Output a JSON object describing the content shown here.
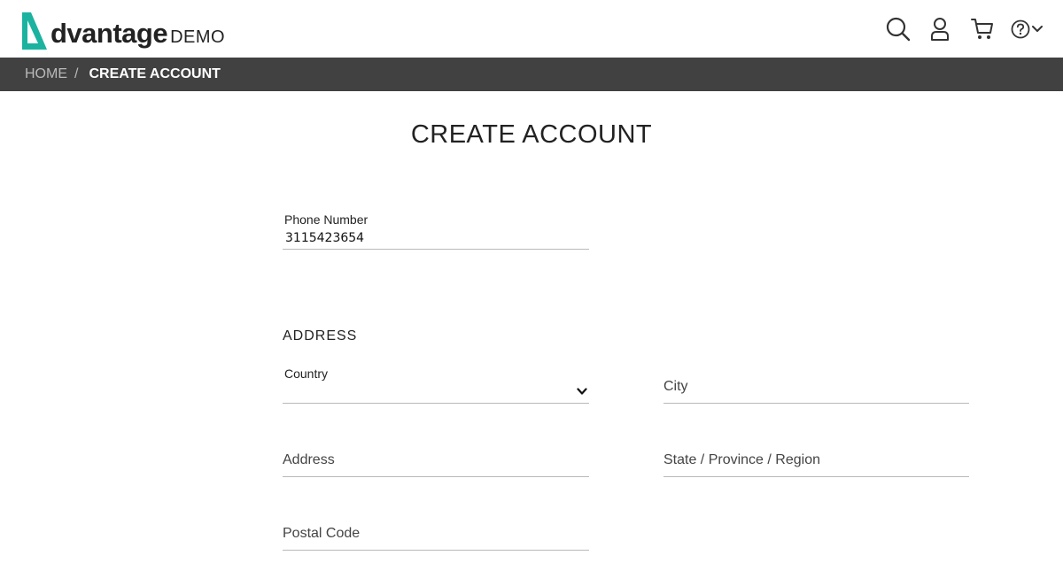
{
  "header": {
    "logo_text": "dvantage",
    "logo_suffix": "DEMO",
    "brand_color": "#1bb3a0",
    "icons": [
      "search-icon",
      "user-icon",
      "cart-icon",
      "help-icon",
      "chevron-down-icon"
    ]
  },
  "breadcrumb": {
    "home": "HOME",
    "separator": "/",
    "current": "CREATE ACCOUNT"
  },
  "page": {
    "title": "CREATE ACCOUNT"
  },
  "phone": {
    "label": "Phone Number",
    "value": "3115423654"
  },
  "address_section": {
    "title": "ADDRESS",
    "country": {
      "label": "Country",
      "value": ""
    },
    "city": {
      "placeholder": "City"
    },
    "address": {
      "placeholder": "Address"
    },
    "state": {
      "placeholder": "State / Province / Region"
    },
    "postal": {
      "placeholder": "Postal Code"
    }
  }
}
